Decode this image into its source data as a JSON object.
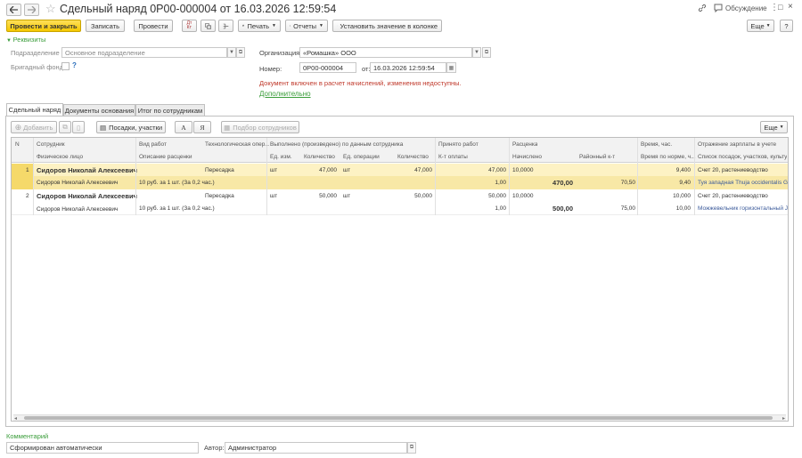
{
  "header": {
    "title": "Сдельный наряд 0Р00-000004 от 16.03.2026 12:59:54",
    "discussion": "Обсуждение"
  },
  "toolbar": {
    "post_close": "Провести и закрыть",
    "save": "Записать",
    "post": "Провести",
    "print": "Печать",
    "reports": "Отчеты",
    "set_value": "Установить значение в колонке",
    "more": "Еще",
    "help": "?"
  },
  "requisites": {
    "toggle": "Реквизиты",
    "subdivision_label": "Подразделение",
    "subdivision_value": "Основное подразделение",
    "brigade_label": "Бригадный фонд:",
    "org_label": "Организация:",
    "org_value": "«Ромашка» ООО",
    "number_label": "Номер:",
    "number_value": "0Р00-000004",
    "from_label": "от:",
    "date_value": "16.03.2026 12:59:54",
    "warning": "Документ включен в расчет начислений, изменения недоступны.",
    "additional": "Дополнительно"
  },
  "tabs": [
    "Сдельный наряд",
    "Документы основания",
    "Итог по сотрудникам"
  ],
  "table_toolbar": {
    "add": "Добавить",
    "plantings": "Посадки, участки",
    "font_a": "А",
    "font_ya": "Я",
    "select_employees": "Подбор сотрудников",
    "more": "Еще"
  },
  "columns": {
    "row1": [
      "N",
      "Сотрудник",
      "Вид работ",
      "Технологическая опер...",
      "Выполнено (произведено) по данным сотрудника",
      "Принято работ",
      "Расценка",
      "Время, час.",
      "Отражение зарплаты в учете"
    ],
    "row2": [
      "Физическое лицо",
      "Описание расценки",
      "Ед. изм.",
      "Количество",
      "Ед. операции",
      "Количество",
      "К-т оплаты",
      "Начислено",
      "Районный к-т",
      "Время по норме, ч...",
      "Список посадок, участков, культур"
    ]
  },
  "rows": [
    {
      "n": "1",
      "employee": "Сидоров Николай Алексеевич",
      "person": "Сидоров Николай Алексеевич",
      "tech_op": "Пересадка",
      "description": "10 руб. за 1 шт. (За 0,2 час.)",
      "unit": "шт",
      "qty": "47,000",
      "op_unit": "шт",
      "op_qty": "47,000",
      "accepted": "47,000",
      "pay_coef": "1,00",
      "rate": "10,0000",
      "accrued": "470,00",
      "regional": "70,50",
      "time": "9,400",
      "time_norm": "9,40",
      "account": "Счет 20, растениеводство",
      "plants": "Туя западная Thuja occidentalis Gold..."
    },
    {
      "n": "2",
      "employee": "Сидоров Николай Алексеевич",
      "person": "Сидоров Николай Алексеевич",
      "tech_op": "Пересадка",
      "description": "10 руб. за 1 шт. (За 0,2 час.)",
      "unit": "шт",
      "qty": "50,000",
      "op_unit": "шт",
      "op_qty": "50,000",
      "accepted": "50,000",
      "pay_coef": "1,00",
      "rate": "10,0000",
      "accrued": "500,00",
      "regional": "75,00",
      "time": "10,000",
      "time_norm": "10,00",
      "account": "Счет 20, растениеводство",
      "plants": "Можжевельник горизонтальный Ju..."
    }
  ],
  "footer": {
    "comment_label": "Комментарий",
    "comment_value": "Сформирован автоматически",
    "author_label": "Автор:",
    "author_value": "Администратор"
  },
  "colors": {
    "primary_button": "#f5c800",
    "selected_row": "#fdf2c4",
    "accent_green": "#3a9d3a",
    "warning_red": "#c0392b"
  }
}
